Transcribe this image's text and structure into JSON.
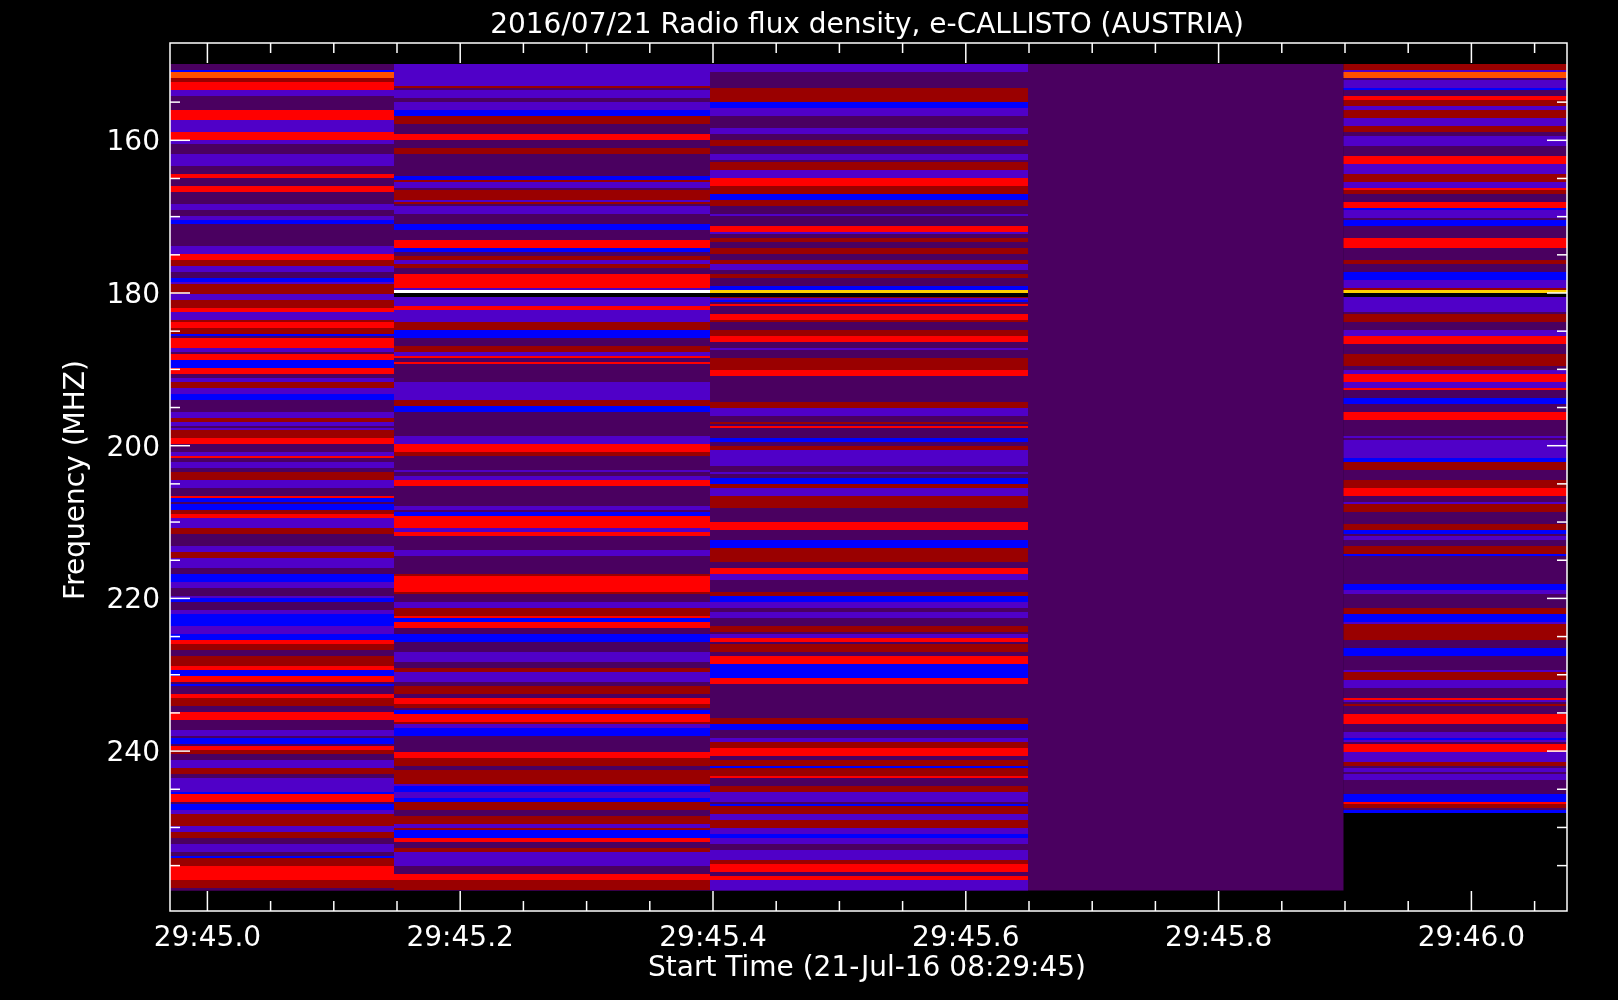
{
  "title": "2016/07/21  Radio flux density, e-CALLISTO (AUSTRIA)",
  "y_axis": {
    "label": "Frequency (MHZ)",
    "ticks": [
      "160",
      "180",
      "200",
      "220",
      "240"
    ]
  },
  "x_axis": {
    "label": "Start Time (21-Jul-16 08:29:45)",
    "ticks": [
      "29:45.0",
      "29:45.2",
      "29:45.4",
      "29:45.6",
      "29:45.8",
      "29:46.0"
    ]
  }
}
